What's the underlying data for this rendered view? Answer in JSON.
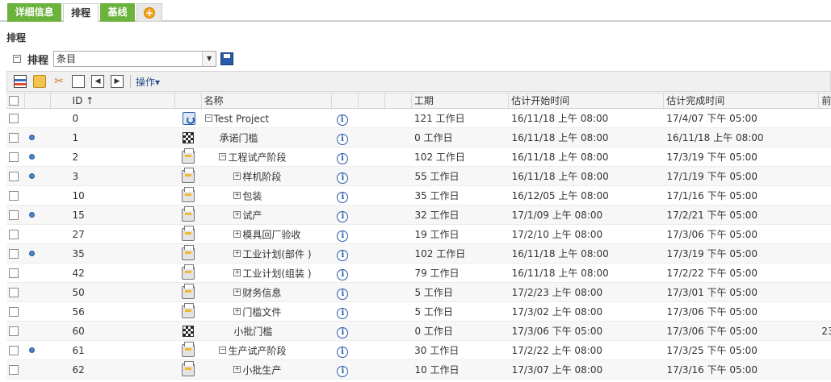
{
  "tabs": [
    {
      "label": "详细信息",
      "state": "green"
    },
    {
      "label": "排程",
      "state": "active"
    },
    {
      "label": "基线",
      "state": "green"
    },
    {
      "label": "+",
      "state": "plus"
    }
  ],
  "section_title": "排程",
  "schedule_bar": {
    "collapse_glyph": "⊟",
    "label": "排程",
    "combo_value": "条目"
  },
  "toolbar": {
    "icons": [
      "gantt-icon",
      "new-folder-icon",
      "cut-icon",
      "paste-icon",
      "outdent-icon",
      "indent-icon"
    ],
    "ops_label": "操作▾"
  },
  "columns": {
    "id": "ID ↑",
    "name": "名称",
    "duration": "工期",
    "start": "估计开始时间",
    "end": "估计完成时间",
    "pred": "前"
  },
  "rows": [
    {
      "dot": false,
      "id": "0",
      "type": "project",
      "level": 0,
      "expand": "⊟",
      "name": "Test Project",
      "dur": "121 工作日",
      "start": "16/11/18 上午 08:00",
      "end": "17/4/07 下午 05:00",
      "pred": ""
    },
    {
      "dot": true,
      "id": "1",
      "type": "milestone",
      "level": 1,
      "expand": "",
      "name": "承诺门槛",
      "dur": "0 工作日",
      "start": "16/11/18 上午 08:00",
      "end": "16/11/18 上午 08:00",
      "pred": ""
    },
    {
      "dot": true,
      "id": "2",
      "type": "task",
      "level": 1,
      "expand": "⊟",
      "name": "工程试产阶段",
      "dur": "102 工作日",
      "start": "16/11/18 上午 08:00",
      "end": "17/3/19 下午 05:00",
      "pred": ""
    },
    {
      "dot": true,
      "id": "3",
      "type": "task",
      "level": 2,
      "expand": "⊞",
      "name": "样机阶段",
      "dur": "55 工作日",
      "start": "16/11/18 上午 08:00",
      "end": "17/1/19 下午 05:00",
      "pred": ""
    },
    {
      "dot": false,
      "id": "10",
      "type": "task",
      "level": 2,
      "expand": "⊞",
      "name": "包装",
      "dur": "35 工作日",
      "start": "16/12/05 上午 08:00",
      "end": "17/1/16 下午 05:00",
      "pred": ""
    },
    {
      "dot": true,
      "id": "15",
      "type": "task",
      "level": 2,
      "expand": "⊞",
      "name": "试产",
      "dur": "32 工作日",
      "start": "17/1/09 上午 08:00",
      "end": "17/2/21 下午 05:00",
      "pred": ""
    },
    {
      "dot": false,
      "id": "27",
      "type": "task",
      "level": 2,
      "expand": "⊞",
      "name": "模具回厂验收",
      "dur": "19 工作日",
      "start": "17/2/10 上午 08:00",
      "end": "17/3/06 下午 05:00",
      "pred": ""
    },
    {
      "dot": true,
      "id": "35",
      "type": "task",
      "level": 2,
      "expand": "⊞",
      "name": "工业计划(部件 )",
      "dur": "102 工作日",
      "start": "16/11/18 上午 08:00",
      "end": "17/3/19 下午 05:00",
      "pred": ""
    },
    {
      "dot": false,
      "id": "42",
      "type": "task",
      "level": 2,
      "expand": "⊞",
      "name": "工业计划(组装 )",
      "dur": "79 工作日",
      "start": "16/11/18 上午 08:00",
      "end": "17/2/22 下午 05:00",
      "pred": ""
    },
    {
      "dot": false,
      "id": "50",
      "type": "task",
      "level": 2,
      "expand": "⊞",
      "name": "财务信息",
      "dur": "5 工作日",
      "start": "17/2/23 上午 08:00",
      "end": "17/3/01 下午 05:00",
      "pred": ""
    },
    {
      "dot": false,
      "id": "56",
      "type": "task",
      "level": 2,
      "expand": "⊞",
      "name": "门槛文件",
      "dur": "5 工作日",
      "start": "17/3/02 上午 08:00",
      "end": "17/3/06 下午 05:00",
      "pred": ""
    },
    {
      "dot": false,
      "id": "60",
      "type": "milestone",
      "level": 2,
      "expand": "",
      "name": "小批门槛",
      "dur": "0 工作日",
      "start": "17/3/06 下午 05:00",
      "end": "17/3/06 下午 05:00",
      "pred": "23"
    },
    {
      "dot": true,
      "id": "61",
      "type": "task",
      "level": 1,
      "expand": "⊟",
      "name": "生产试产阶段",
      "dur": "30 工作日",
      "start": "17/2/22 上午 08:00",
      "end": "17/3/25 下午 05:00",
      "pred": ""
    },
    {
      "dot": false,
      "id": "62",
      "type": "task",
      "level": 2,
      "expand": "⊞",
      "name": "小批生产",
      "dur": "10 工作日",
      "start": "17/3/07 上午 08:00",
      "end": "17/3/16 下午 05:00",
      "pred": ""
    }
  ],
  "colors": {
    "tab_green": "#6cb33e",
    "link_blue": "#2a5aa8",
    "dot_blue": "#4a86c8"
  }
}
